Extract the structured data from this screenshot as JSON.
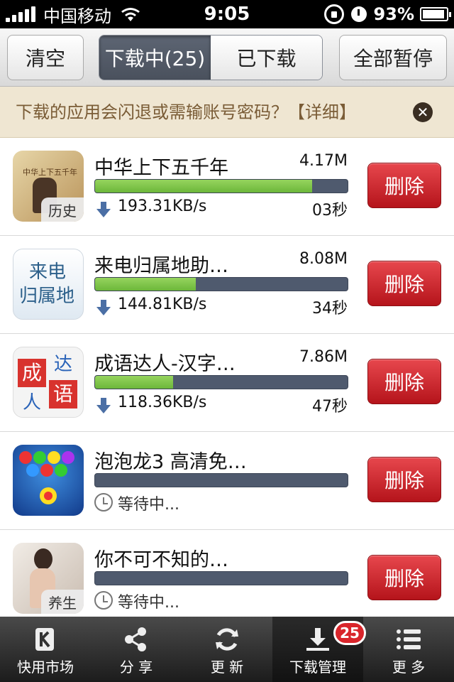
{
  "status_bar": {
    "carrier": "中国移动",
    "time": "9:05",
    "battery": "93%",
    "battery_level": 0.93
  },
  "toolbar": {
    "clear_label": "清空",
    "downloading_tab": "下载中(25)",
    "downloaded_tab": "已下载",
    "pause_all_label": "全部暂停"
  },
  "notice": {
    "text": "下载的应用会闪退或需输账号密码？【详细】",
    "close_icon": "close-icon"
  },
  "downloads": [
    {
      "name": "中华上下五千年",
      "size": "4.17M",
      "progress": 0.86,
      "speed": "193.31KB/s",
      "eta": "03秒",
      "status": "downloading",
      "icon_tag": "历史",
      "icon": "history-book-icon"
    },
    {
      "name": "来电归属地助…",
      "size": "8.08M",
      "progress": 0.4,
      "speed": "144.81KB/s",
      "eta": "34秒",
      "status": "downloading",
      "icon_tag": "来电归属地",
      "icon": "caller-location-icon"
    },
    {
      "name": "成语达人-汉字…",
      "size": "7.86M",
      "progress": 0.31,
      "speed": "118.36KB/s",
      "eta": "47秒",
      "status": "downloading",
      "icon_tag": "成达人语",
      "icon": "idiom-game-icon"
    },
    {
      "name": "泡泡龙3 高清免…",
      "progress": 0,
      "status_text": "等待中...",
      "status": "waiting",
      "icon": "bubble-game-icon"
    },
    {
      "name": "你不可不知的…",
      "progress": 0,
      "status_text": "等待中...",
      "status": "waiting",
      "icon_tag": "养生",
      "icon": "health-icon"
    }
  ],
  "delete_label": "删除",
  "tabbar": {
    "tabs": [
      {
        "label": "快用市场",
        "icon": "market-icon"
      },
      {
        "label": "分 享",
        "icon": "share-icon"
      },
      {
        "label": "更 新",
        "icon": "refresh-icon"
      },
      {
        "label": "下载管理",
        "icon": "download-icon",
        "badge": "25",
        "active": true
      },
      {
        "label": "更 多",
        "icon": "menu-icon"
      }
    ]
  },
  "colors": {
    "progress_fill": "#7cc444",
    "progress_track": "#4f5a6e",
    "delete_button": "#cc1f26",
    "notice_bg": "#efe6d2"
  }
}
